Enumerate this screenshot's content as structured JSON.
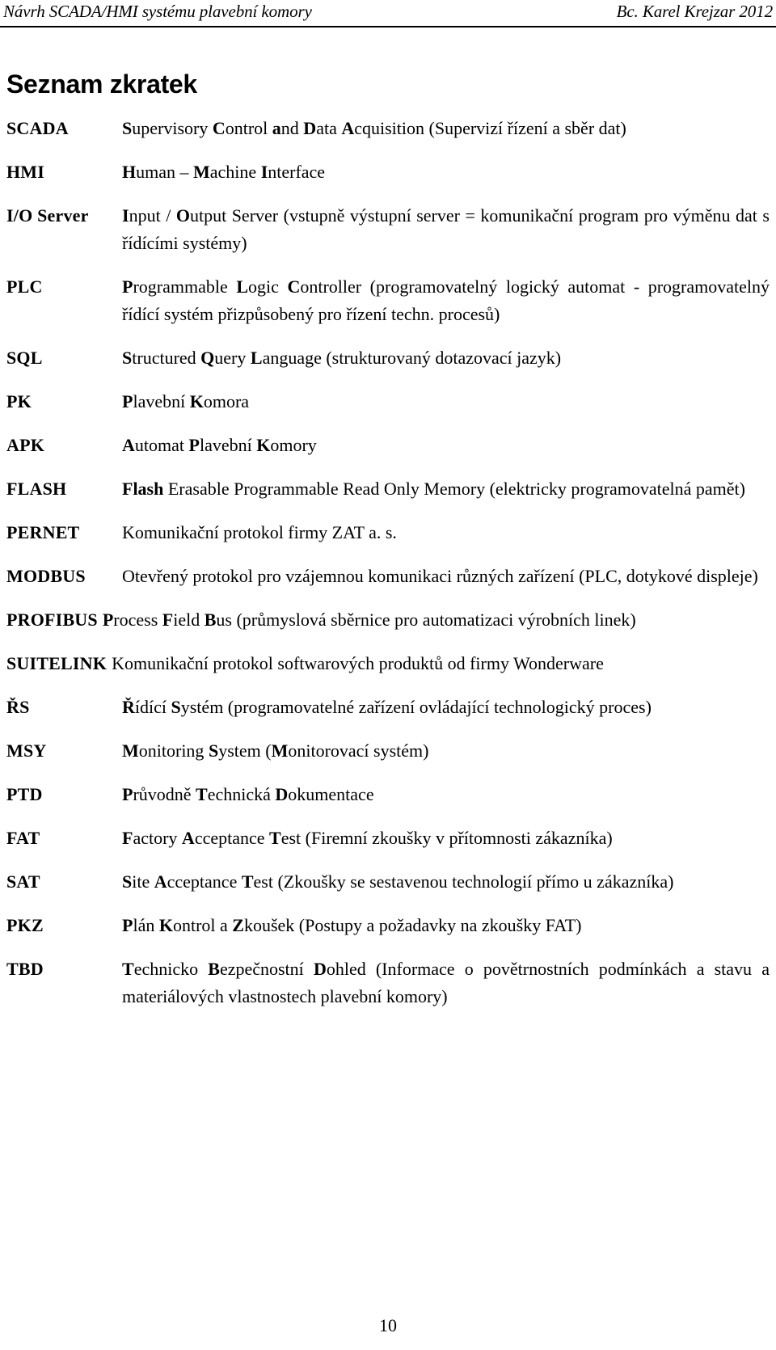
{
  "header": {
    "left": "Návrh SCADA/HMI systému plavební komory",
    "right": "Bc. Karel Krejzar  2012"
  },
  "title": "Seznam zkratek",
  "page_number": "10",
  "abbreviations": [
    {
      "term": "SCADA",
      "definition": "Supervisory Control and Data Acquisition (Supervizí řízení a sběr dat)",
      "bold_initials": [
        "S",
        "C",
        "a",
        "D",
        "A"
      ],
      "justified": false
    },
    {
      "term": "HMI",
      "definition": "Human – Machine Interface",
      "bold_initials": [
        "H",
        "M",
        "I"
      ],
      "justified": false
    },
    {
      "term": "I/O Server",
      "definition": "Input / Output Server (vstupně výstupní server = komunikační program pro výměnu dat s řídícími systémy)",
      "bold_initials": [
        "I",
        "O"
      ],
      "justified": true
    },
    {
      "term": "PLC",
      "definition": "Programmable Logic Controller (programovatelný logický automat - programovatelný řídící systém přizpůsobený pro řízení techn. procesů)",
      "bold_initials": [
        "P",
        "L",
        "C"
      ],
      "justified": true
    },
    {
      "term": "SQL",
      "definition": "Structured Query Language (strukturovaný dotazovací jazyk)",
      "bold_initials": [
        "S",
        "Q",
        "L"
      ],
      "justified": false
    },
    {
      "term": "PK",
      "definition": "Plavební Komora",
      "bold_initials": [
        "P",
        "K"
      ],
      "justified": false
    },
    {
      "term": "APK",
      "definition": "Automat Plavební Komory",
      "bold_initials": [
        "A",
        "P",
        "K"
      ],
      "justified": false
    },
    {
      "term": "FLASH",
      "definition": "Flash Erasable Programmable Read Only Memory (elektricky programovatelná pamět)",
      "bold_initials": [
        "Flash"
      ],
      "justified": true
    },
    {
      "term": "PERNET",
      "definition": "Komunikační protokol firmy ZAT a. s.",
      "bold_initials": [],
      "justified": false
    },
    {
      "term": "MODBUS",
      "definition": "Otevřený protokol pro vzájemnou komunikaci různých zařízení (PLC, dotykové displeje)",
      "bold_initials": [],
      "justified": true
    },
    {
      "term": "PROFIBUS",
      "definition": "Process Field  Bus (průmyslová sběrnice pro automatizaci výrobních linek)",
      "bold_initials": [
        "P",
        "F",
        "B"
      ],
      "justified": false
    },
    {
      "term": "SUITELINK",
      "definition": "Komunikační protokol softwarových produktů od firmy Wonderware",
      "bold_initials": [],
      "justified": false
    },
    {
      "term": "ŘS",
      "definition": "Řídící Systém (programovatelné zařízení ovládající technologický proces)",
      "bold_initials": [
        "Ř",
        "S"
      ],
      "justified": false
    },
    {
      "term": "MSY",
      "definition": "Monitoring System (Monitorovací systém)",
      "bold_initials": [
        "M",
        "S",
        "M"
      ],
      "justified": false
    },
    {
      "term": "PTD",
      "definition": "Průvodně Technická Dokumentace",
      "bold_initials": [
        "P",
        "T",
        "D"
      ],
      "justified": false
    },
    {
      "term": "FAT",
      "definition": "Factory Acceptance Test (Firemní zkoušky v přítomnosti zákazníka)",
      "bold_initials": [
        "F",
        "A",
        "T"
      ],
      "justified": false
    },
    {
      "term": "SAT",
      "definition": "Site Acceptance Test (Zkoušky se sestavenou technologií přímo u zákazníka)",
      "bold_initials": [
        "S",
        "A",
        "T"
      ],
      "justified": true
    },
    {
      "term": "PKZ",
      "definition": "Plán Kontrol a Zkoušek (Postupy a požadavky na zkoušky FAT)",
      "bold_initials": [
        "P",
        "K",
        "Z"
      ],
      "justified": false
    },
    {
      "term": "TBD",
      "definition": "Technicko Bezpečnostní Dohled (Informace o povětrnostních podmínkách a stavu a materiálových vlastnostech plavební komory)",
      "bold_initials": [
        "T",
        "B",
        "D"
      ],
      "justified": true
    }
  ]
}
